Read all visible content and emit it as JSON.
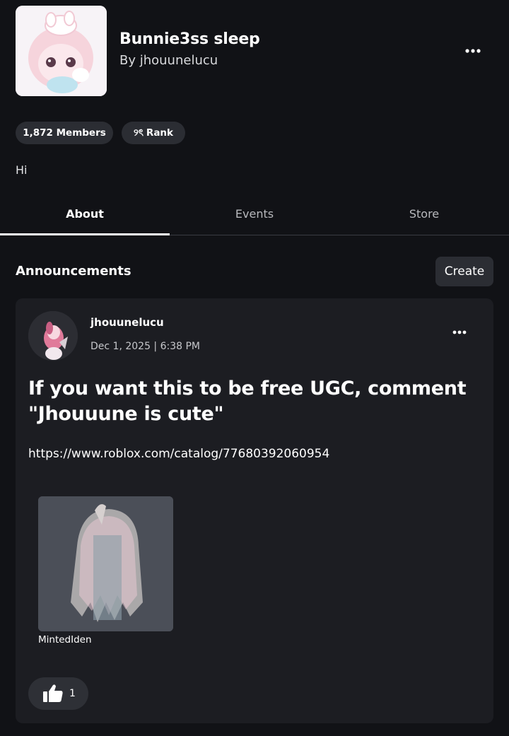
{
  "group": {
    "title": "Bunnie3ss sleep",
    "owner": "By jhouunelucu",
    "members_label": "1,872 Members",
    "rank_prefix": "୨ৎ",
    "rank_label": "Rank",
    "description": "Hi"
  },
  "tabs": [
    {
      "label": "About",
      "active": true
    },
    {
      "label": "Events",
      "active": false
    },
    {
      "label": "Store",
      "active": false
    }
  ],
  "announcements": {
    "title": "Announcements",
    "create_label": "Create",
    "post": {
      "author": "jhouunelucu",
      "date": "Dec 1, 2025 | 6:38 PM",
      "headline": "If you want this to be free UGC, comment \"Jhouuune is cute\"",
      "link": "https://www.roblox.com/catalog/77680392060954",
      "item": {
        "name": "MintedIden"
      },
      "likes": "1"
    }
  },
  "icons": {
    "header_more": "more-horizontal-icon",
    "post_more": "more-horizontal-icon",
    "like": "thumbs-up-icon"
  },
  "colors": {
    "background": "#111216",
    "card": "#1c1d22",
    "chip": "#2b2d33",
    "text": "#ffffff",
    "muted_text": "#b8b9bd"
  }
}
